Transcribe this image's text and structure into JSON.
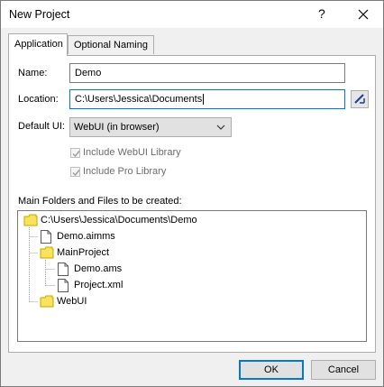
{
  "window": {
    "title": "New Project",
    "help_glyph": "?"
  },
  "tabs": [
    {
      "label": "Application",
      "active": true
    },
    {
      "label": "Optional Naming",
      "active": false
    }
  ],
  "form": {
    "name_label": "Name:",
    "name_value": "Demo",
    "location_label": "Location:",
    "location_value": "C:\\Users\\Jessica\\Documents",
    "default_ui_label": "Default UI:",
    "default_ui_value": "WebUI (in browser)",
    "include_webui_label": "Include WebUI Library",
    "include_pro_label": "Include Pro Library",
    "include_webui_checked": true,
    "include_pro_checked": true
  },
  "tree": {
    "label": "Main Folders and Files to be created:",
    "nodes": [
      {
        "text": "C:\\Users\\Jessica\\Documents\\Demo",
        "icon": "folder-icon"
      },
      {
        "text": "Demo.aimms",
        "icon": "file-icon"
      },
      {
        "text": "MainProject",
        "icon": "folder-icon"
      },
      {
        "text": "Demo.ams",
        "icon": "file-icon"
      },
      {
        "text": "Project.xml",
        "icon": "file-icon"
      },
      {
        "text": "WebUI",
        "icon": "folder-icon"
      }
    ]
  },
  "buttons": {
    "ok": "OK",
    "cancel": "Cancel"
  },
  "colors": {
    "accent": "#0078d7",
    "folder": "#f8e45c",
    "folder_outline": "#c9a400"
  }
}
